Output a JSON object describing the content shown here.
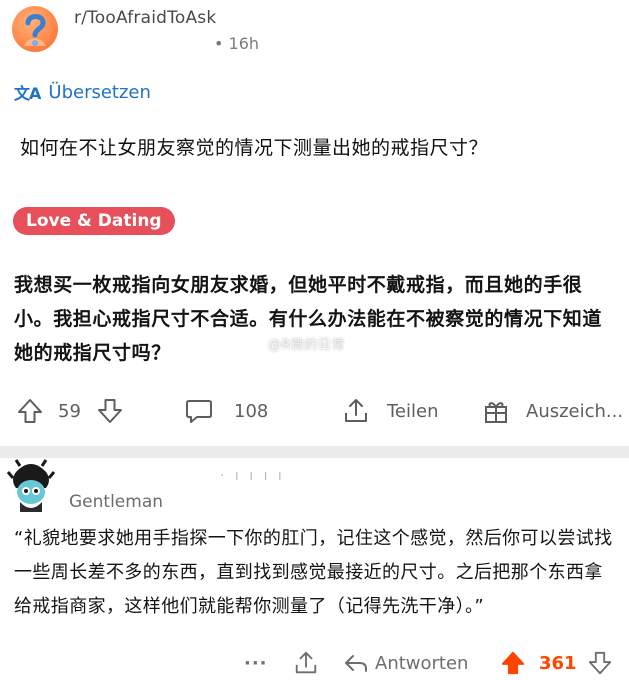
{
  "post": {
    "subreddit": "r/TooAfraidToAsk",
    "time": "• 16h",
    "translate_icon": "文A",
    "translate_label": "Übersetzen",
    "title": "如何在不让女朋友察觉的情况下测量出她的戒指尺寸？",
    "flair": "Love & Dating",
    "body": "我想买一枚戒指向女朋友求婚，但她平时不戴戒指，而且她的手很小。我担心戒指尺寸不合适。有什么办法能在不被察觉的情况下知道她的戒指尺寸吗？",
    "actions": {
      "upvotes": "59",
      "comments": "108",
      "share_label": "Teilen",
      "award_label": "Auszeich..."
    }
  },
  "comment": {
    "author": "Gentleman",
    "top_marks": "·  ı  ı ı ı",
    "body": "“礼貌地要求她用手指探一下你的肛门，记住这个感觉，然后你可以尝试找一些周长差不多的东西，直到找到感觉最接近的尺寸。之后把那个东西拿给戒指商家，这样他们就能帮你测量了（记得先洗干净）。”",
    "actions": {
      "more": "···",
      "reply_label": "Antworten",
      "votes": "361"
    }
  },
  "watermark": "@R微的日常",
  "colors": {
    "accent_blue": "#1f72c5",
    "flair_red": "#e7505a",
    "upvote_orange": "#ff4500",
    "divider_gray": "#ececec"
  },
  "icons": {
    "subreddit_avatar": "question-mark-icon",
    "translate": "translate-icon",
    "upvote": "arrow-up-icon",
    "downvote": "arrow-down-icon",
    "comment": "comment-bubble-icon",
    "share": "share-icon",
    "award": "gift-icon",
    "reply": "reply-arrow-icon"
  }
}
